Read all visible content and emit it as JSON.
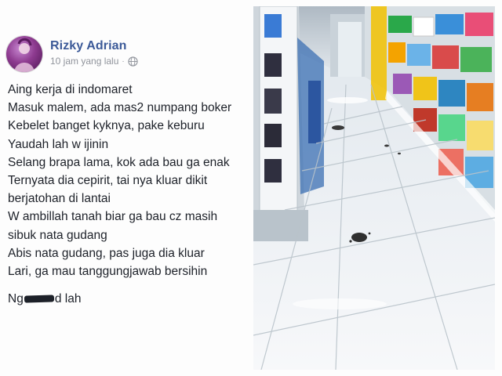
{
  "post": {
    "author": "Rizky Adrian",
    "time": "10 jam yang lalu",
    "separator": "·",
    "privacy_icon": "globe-icon",
    "lines": [
      "Aing kerja di indomaret",
      "Masuk malem, ada mas2 numpang boker",
      "Kebelet banget kyknya, pake keburu",
      "Yaudah lah w ijinin",
      "Selang brapa lama, kok ada bau ga enak",
      "Ternyata dia cepirit, tai nya kluar dikit",
      "berjatohan di lantai",
      "W ambillah tanah biar ga bau cz masih",
      "sibuk nata gudang",
      "Abis nata gudang, pas juga dia kluar",
      "Lari, ga mau tanggungjawab bersihin"
    ],
    "last_line_prefix": "Ng",
    "last_line_suffix": "d lah"
  },
  "photo": {
    "floor_color": "#f2f4f6",
    "shelf_color": "#d7dde2"
  }
}
